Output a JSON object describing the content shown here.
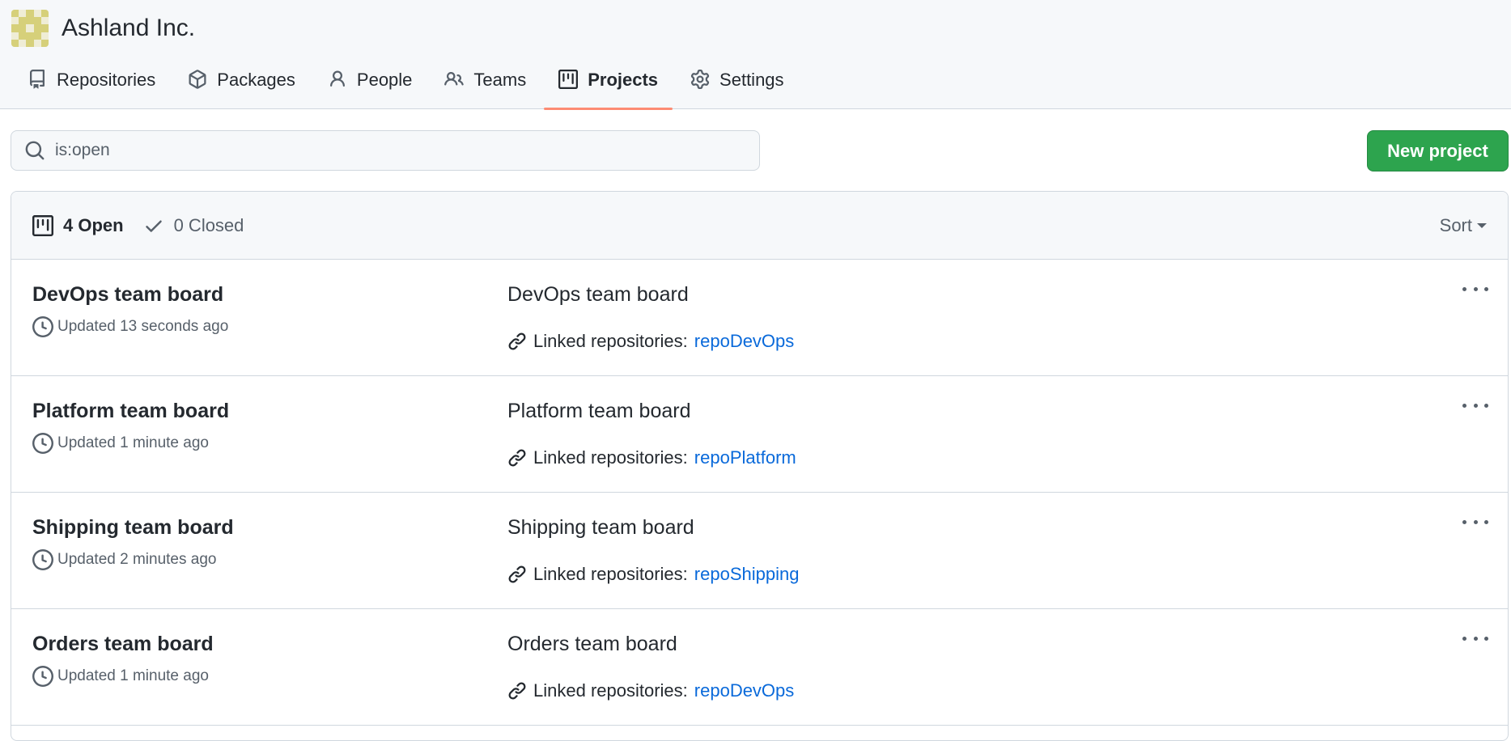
{
  "org": {
    "name": "Ashland Inc.",
    "avatar_colors": [
      "#d6d07a",
      "#efedd6"
    ]
  },
  "tabs": [
    {
      "label": "Repositories",
      "icon": "repo-icon",
      "active": false
    },
    {
      "label": "Packages",
      "icon": "package-icon",
      "active": false
    },
    {
      "label": "People",
      "icon": "person-icon",
      "active": false
    },
    {
      "label": "Teams",
      "icon": "people-icon",
      "active": false
    },
    {
      "label": "Projects",
      "icon": "project-icon",
      "active": true
    },
    {
      "label": "Settings",
      "icon": "gear-icon",
      "active": false
    }
  ],
  "search": {
    "value": "is:open",
    "icon": "search-icon"
  },
  "new_project_label": "New project",
  "states": {
    "open_label": "4 Open",
    "closed_label": "0 Closed"
  },
  "sort_label": "Sort",
  "projects": [
    {
      "title": "DevOps team board",
      "updated": "Updated 13 seconds ago",
      "description": "DevOps team board",
      "linked_label": "Linked repositories:",
      "linked_repo": "repoDevOps"
    },
    {
      "title": "Platform team board",
      "updated": "Updated 1 minute ago",
      "description": "Platform team board",
      "linked_label": "Linked repositories:",
      "linked_repo": "repoPlatform"
    },
    {
      "title": "Shipping team board",
      "updated": "Updated 2 minutes ago",
      "description": "Shipping team board",
      "linked_label": "Linked repositories:",
      "linked_repo": "repoShipping"
    },
    {
      "title": "Orders team board",
      "updated": "Updated 1 minute ago",
      "description": "Orders team board",
      "linked_label": "Linked repositories:",
      "linked_repo": "repoDevOps"
    }
  ],
  "colors": {
    "accent_underline": "#fd8c73",
    "primary_button": "#2da44e",
    "link": "#0969da"
  }
}
